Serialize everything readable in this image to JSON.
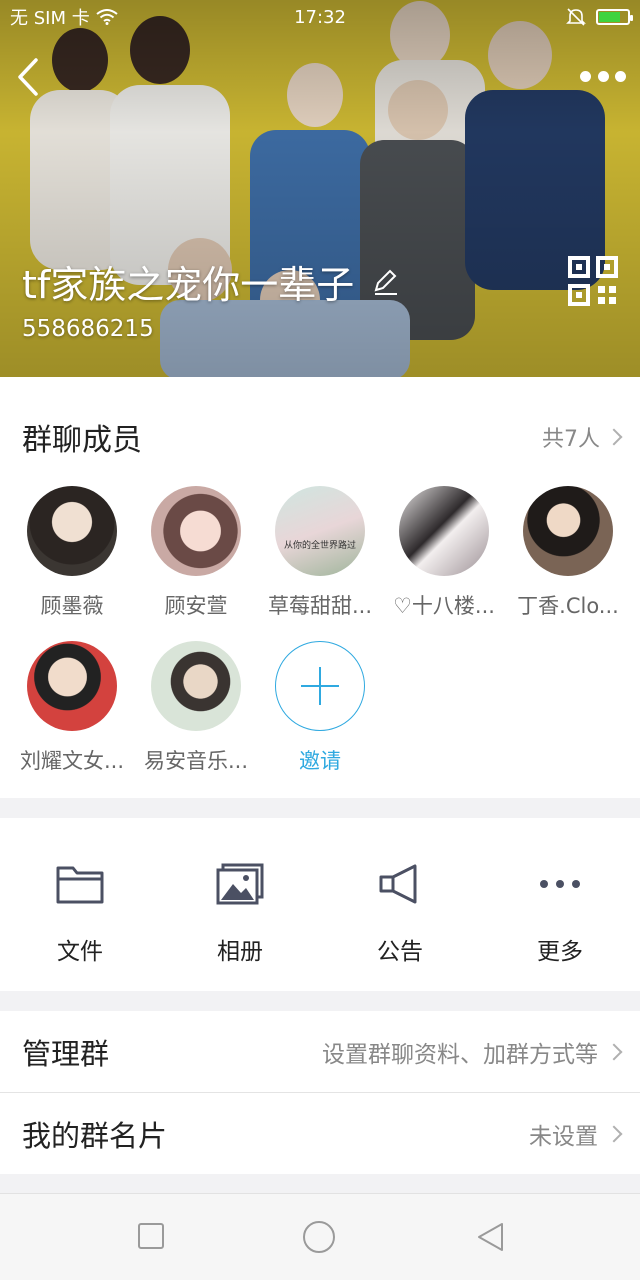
{
  "status_bar": {
    "carrier": "无 SIM 卡",
    "time": "17:32",
    "battery_level": 0.7,
    "icons": [
      "wifi-icon",
      "bell-off-icon",
      "battery-charging-icon"
    ]
  },
  "header": {
    "group_name": "tf家族之宠你一辈子",
    "group_id": "558686215",
    "icons": [
      "back-icon",
      "more-icon",
      "edit-icon",
      "qr-code-icon"
    ]
  },
  "members": {
    "title": "群聊成员",
    "count_label": "共7人",
    "items": [
      {
        "name": "顾墨薇"
      },
      {
        "name": "顾安萱"
      },
      {
        "name": "草莓甜甜..."
      },
      {
        "name": "♡十八楼..."
      },
      {
        "name": "丁香.Clo..."
      },
      {
        "name": "刘耀文女..."
      },
      {
        "name": "易安音乐..."
      }
    ],
    "avatar_caption": "从你的全世界路过",
    "invite_label": "邀请"
  },
  "actions": [
    {
      "label": "文件",
      "icon": "folder-icon"
    },
    {
      "label": "相册",
      "icon": "album-icon"
    },
    {
      "label": "公告",
      "icon": "megaphone-icon"
    },
    {
      "label": "更多",
      "icon": "more-dots-icon"
    }
  ],
  "rows": {
    "manage": {
      "title": "管理群",
      "value": "设置群聊资料、加群方式等"
    },
    "card": {
      "title": "我的群名片",
      "value": "未设置"
    }
  },
  "nav": {
    "icons": [
      "recent-apps-icon",
      "home-icon",
      "back-nav-icon"
    ]
  },
  "colors": {
    "accent": "#2fa9e0",
    "hero_bg": "#cbb529",
    "action_icon": "#4b5063"
  }
}
